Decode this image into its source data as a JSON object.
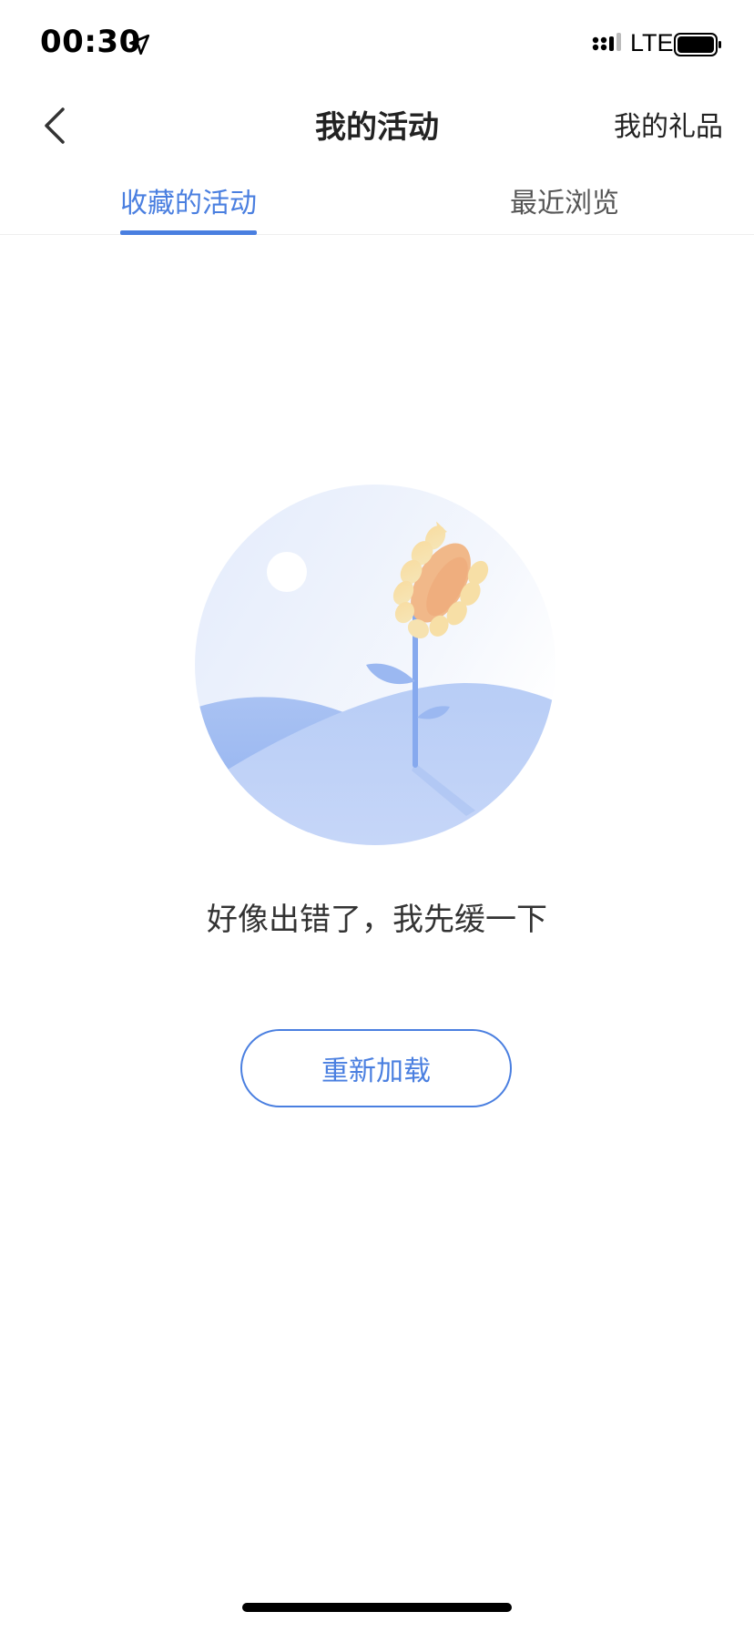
{
  "status_bar": {
    "time": "00:30",
    "network": "LTE",
    "icons": [
      "location-arrow-icon",
      "signal-icon",
      "battery-icon"
    ]
  },
  "nav": {
    "back_icon": "chevron-left-icon",
    "title": "我的活动",
    "right_link": "我的礼品"
  },
  "tabs": [
    {
      "label": "收藏的活动",
      "active": true
    },
    {
      "label": "最近浏览",
      "active": false
    }
  ],
  "empty_state": {
    "illustration": "sunflower-hill-illustration",
    "message": "好像出错了，我先缓一下",
    "button_label": "重新加载"
  },
  "colors": {
    "accent": "#4a7fe0",
    "text_primary": "#222222",
    "text_secondary": "#555555",
    "divider": "#eeeeee"
  }
}
